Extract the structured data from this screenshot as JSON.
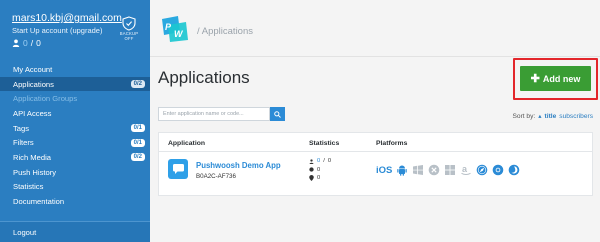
{
  "sidebar": {
    "email": "mars10.kbj@gmail.com",
    "plan": "Start Up account (upgrade)",
    "counter_current": "0",
    "counter_sep": " / ",
    "counter_total": "0",
    "backup_line1": "BACKUP",
    "backup_line2": "OFF",
    "items": [
      {
        "label": "My Account",
        "badge": ""
      },
      {
        "label": "Applications",
        "badge": "0/2"
      },
      {
        "label": "Application Groups",
        "badge": ""
      },
      {
        "label": "API Access",
        "badge": ""
      },
      {
        "label": "Tags",
        "badge": "0/1"
      },
      {
        "label": "Filters",
        "badge": "0/1"
      },
      {
        "label": "Rich Media",
        "badge": "0/2"
      },
      {
        "label": "Push History",
        "badge": ""
      },
      {
        "label": "Statistics",
        "badge": ""
      },
      {
        "label": "Documentation",
        "badge": ""
      }
    ],
    "logout": "Logout"
  },
  "header": {
    "breadcrumb_sep": "/",
    "breadcrumb": "Applications"
  },
  "main": {
    "title": "Applications",
    "add_button": "Add new",
    "search_placeholder": "Enter application name or code...",
    "sort_label": "Sort by:",
    "sort_options": [
      "title",
      "subscribers"
    ],
    "columns": [
      "Application",
      "Statistics",
      "Platforms"
    ],
    "app": {
      "name": "Pushwoosh Demo App",
      "code": "B0A2C-AF736",
      "stats_users_a": "0",
      "stats_users_b": "0",
      "stats_sent": "0",
      "stats_opened": "0",
      "platform_ios": "iOS"
    }
  },
  "colors": {
    "sidebar": "#2b7ec1",
    "sidebar_active": "#1d5f97",
    "add_button": "#3a9d34",
    "highlight": "#e3262b",
    "link": "#2b8bd6"
  },
  "icons": {
    "backup": "shield-icon",
    "user": "user-icon",
    "search": "search-icon",
    "app": "chat-bubble-icon",
    "platforms": [
      "android-icon",
      "windows-phone-icon",
      "blackberry-icon",
      "windows-icon",
      "amazon-icon",
      "safari-icon",
      "chrome-icon",
      "firefox-icon"
    ]
  }
}
